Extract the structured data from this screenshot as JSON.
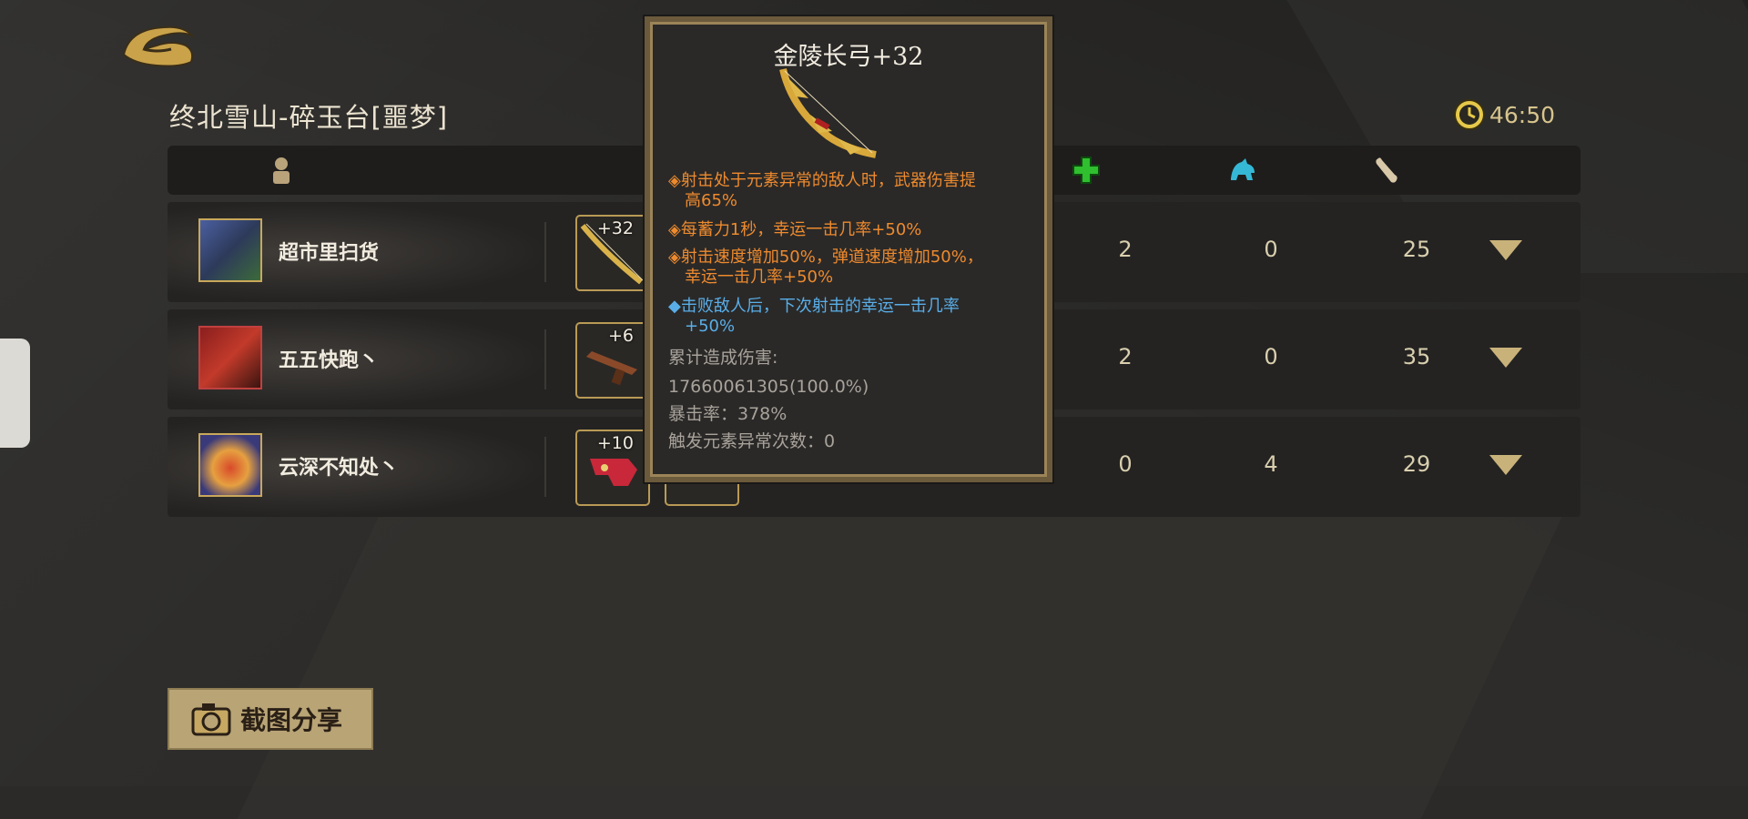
{
  "stage": {
    "title": "终北雪山-碎玉台[噩梦]"
  },
  "timer": {
    "value": "46:50",
    "icon": "clock-icon"
  },
  "header": {
    "icons": [
      "player-icon",
      "heal-cross-icon",
      "beast-icon",
      "bone-icon"
    ],
    "colors": {
      "heal": "#2fbf2f",
      "beast": "#35b8d6",
      "bone": "#d8c8a8"
    }
  },
  "players": [
    {
      "name": "超市里扫货",
      "weapon_level": "+32",
      "col_heal": "2",
      "col_beast": "0",
      "col_bone": "25"
    },
    {
      "name": "五五快跑丶",
      "weapon_level": "+6",
      "col_heal": "2",
      "col_beast": "0",
      "col_bone": "35"
    },
    {
      "name": "云深不知处丶",
      "weapon_level": "+10",
      "col_heal": "0",
      "col_beast": "4",
      "col_bone": "29"
    }
  ],
  "share": {
    "label": "截图分享",
    "icon": "camera-icon"
  },
  "tooltip": {
    "title": "金陵长弓+32",
    "effects": [
      {
        "text": "◈射击处于元素异常的敌人时，武器伤害提高65%",
        "line1": "◈射击处于元素异常的敌人时，武器伤害提",
        "line2": "高65%",
        "color": "#ee8a2e"
      },
      {
        "text": "◈每蓄力1秒，幸运一击几率+50%",
        "line1": "◈每蓄力1秒，幸运一击几率+50%",
        "color": "#ee8a2e"
      },
      {
        "text": "◈射击速度增加50%，弹道速度增加50%，幸运一击几率+50%",
        "line1": "◈射击速度增加50%，弹道速度增加50%，",
        "line2": "幸运一击几率+50%",
        "color": "#ee8a2e"
      },
      {
        "text": "◆击败敌人后，下次射击的幸运一击几率+50%",
        "line1": "◆击败敌人后，下次射击的幸运一击几率",
        "line2": "+50%",
        "color": "#5aaee8"
      }
    ],
    "stats": {
      "damage_label": "累计造成伤害:",
      "damage_value": "17660061305(100.0%)",
      "crit": "暴击率：378%",
      "element_trigger": "触发元素异常次数：0"
    }
  }
}
